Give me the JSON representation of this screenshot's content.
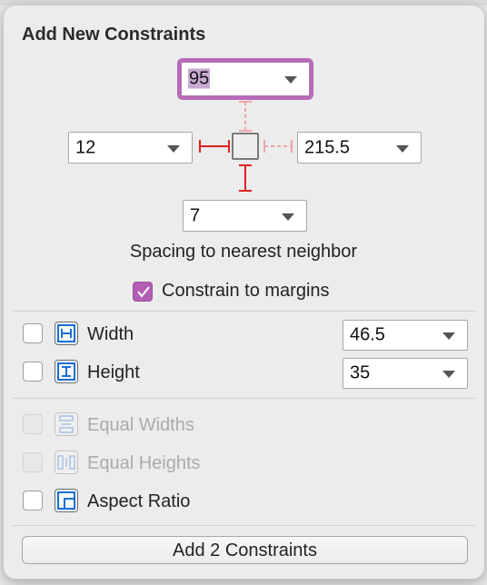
{
  "title": "Add New Constraints",
  "spacing": {
    "top": "95",
    "left": "12",
    "right": "215.5",
    "bottom": "7",
    "caption": "Spacing to nearest neighbor"
  },
  "margins": {
    "label": "Constrain to margins",
    "checked": true
  },
  "size": {
    "width": {
      "label": "Width",
      "value": "46.5",
      "checked": false
    },
    "height": {
      "label": "Height",
      "value": "35",
      "checked": false
    }
  },
  "equal": {
    "widths": {
      "label": "Equal Widths",
      "enabled": false
    },
    "heights": {
      "label": "Equal Heights",
      "enabled": false
    }
  },
  "aspect": {
    "label": "Aspect Ratio",
    "checked": false
  },
  "add_button": "Add 2 Constraints",
  "colors": {
    "accent": "#b25eb2",
    "active_constraint": "#e0201f",
    "inactive_constraint": "#f0a5a5",
    "icon_blue": "#1a6fd6"
  }
}
